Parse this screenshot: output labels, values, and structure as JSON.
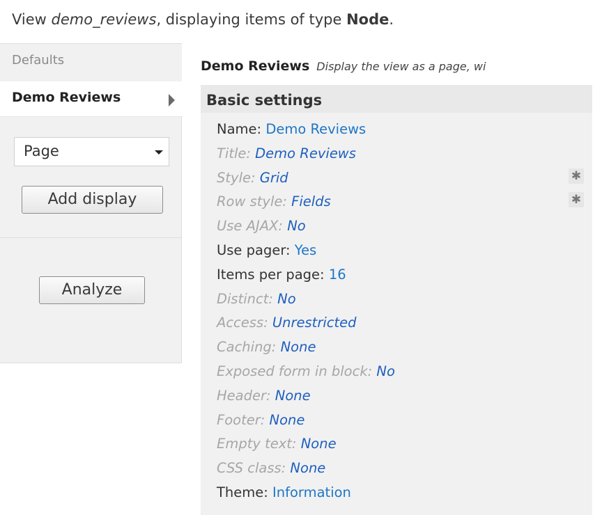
{
  "header": {
    "prefix": "View ",
    "view_name": "demo_reviews",
    "middle": ", displaying items of type ",
    "type": "Node",
    "suffix": "."
  },
  "tabs": {
    "defaults": "Defaults",
    "active": "Demo Reviews"
  },
  "left_panel": {
    "select_value": "Page",
    "add_display_button": "Add display",
    "analyze_button": "Analyze"
  },
  "main": {
    "display_title": "Demo Reviews",
    "display_description": "Display the view as a page, wi",
    "section_title": "Basic settings",
    "settings": [
      {
        "label": "Name: ",
        "value": "Demo Reviews",
        "dim": false
      },
      {
        "label": "Title: ",
        "value": "Demo Reviews",
        "dim": true
      },
      {
        "label": "Style: ",
        "value": "Grid",
        "dim": true,
        "gear": true
      },
      {
        "label": "Row style: ",
        "value": "Fields",
        "dim": true,
        "gear": true
      },
      {
        "label": "Use AJAX: ",
        "value": "No",
        "dim": true
      },
      {
        "label": "Use pager: ",
        "value": "Yes",
        "dim": false
      },
      {
        "label": "Items per page: ",
        "value": "16",
        "dim": false
      },
      {
        "label": "Distinct: ",
        "value": "No",
        "dim": true
      },
      {
        "label": "Access: ",
        "value": "Unrestricted",
        "dim": true
      },
      {
        "label": "Caching: ",
        "value": "None",
        "dim": true
      },
      {
        "label": "Exposed form in block: ",
        "value": "No",
        "dim": true
      },
      {
        "label": "Header: ",
        "value": "None",
        "dim": true
      },
      {
        "label": "Footer: ",
        "value": "None",
        "dim": true
      },
      {
        "label": "Empty text: ",
        "value": "None",
        "dim": true
      },
      {
        "label": "CSS class: ",
        "value": "None",
        "dim": true
      },
      {
        "label": "Theme: ",
        "value": "Information",
        "dim": false
      }
    ]
  },
  "icons": {
    "tab_arrow": "triangle-right-icon",
    "select_caret": "chevron-down-icon",
    "gear": "gear-icon"
  },
  "colors": {
    "link": "#1e76c7",
    "dim_label": "#a6a6a6",
    "panel_bg": "#f1f1f1"
  }
}
